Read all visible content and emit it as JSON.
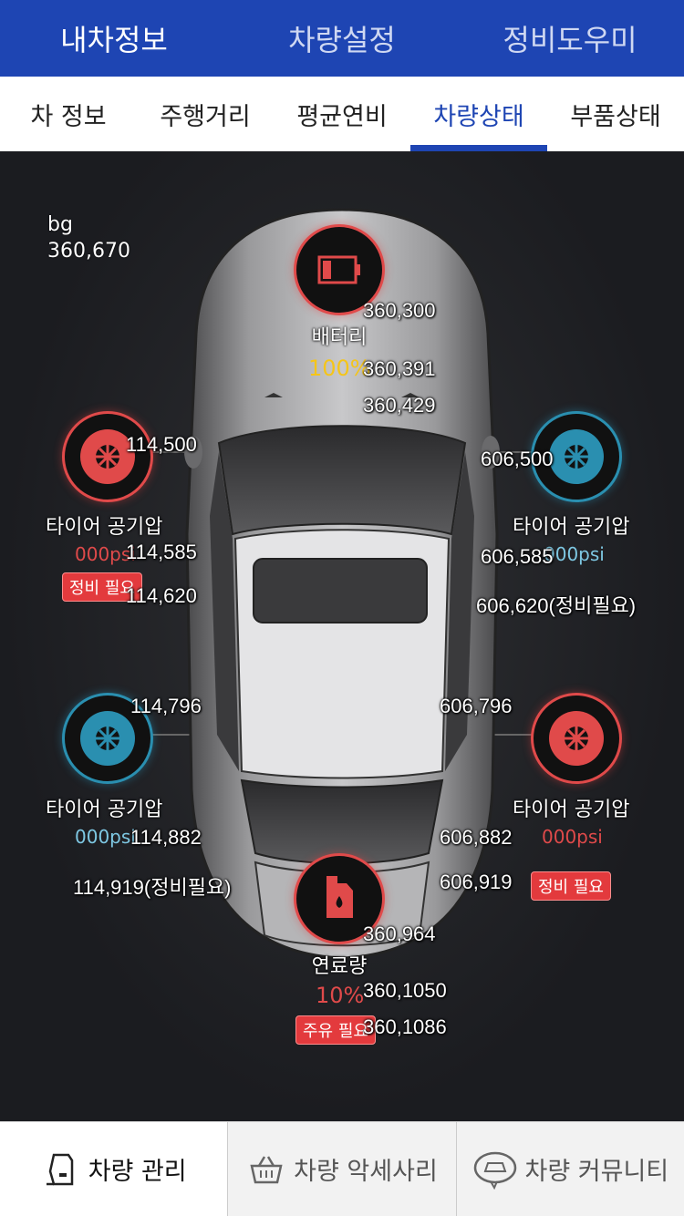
{
  "header": {
    "tabs": [
      "내차정보",
      "차량설정",
      "정비도우미"
    ]
  },
  "subnav": {
    "tabs": [
      "차 정보",
      "주행거리",
      "평균연비",
      "차량상태",
      "부품상태"
    ],
    "active_index": 3
  },
  "status": {
    "bg_label": "bg",
    "bg_coord": "360,670",
    "battery": {
      "label": "배터리",
      "value": "100%",
      "coords": [
        "360,300",
        "360,391",
        "360,429"
      ]
    },
    "tire_fl": {
      "label": "타이어 공기압",
      "value": "000psi",
      "badge": "정비 필요",
      "coords": [
        "114,500",
        "114,585",
        "114,620"
      ]
    },
    "tire_fr": {
      "label": "타이어 공기압",
      "value": "000psi",
      "coords": [
        "606,500",
        "606,585",
        "606,620(정비필요)"
      ]
    },
    "tire_rl": {
      "label": "타이어 공기압",
      "value": "000psi",
      "coords": [
        "114,796",
        "114,882",
        "114,919(정비필요)"
      ]
    },
    "tire_rr": {
      "label": "타이어 공기압",
      "value": "000psi",
      "badge": "정비 필요",
      "coords": [
        "606,796",
        "606,882",
        "606,919"
      ]
    },
    "fuel": {
      "label": "연료량",
      "value": "10%",
      "badge": "주유 필요",
      "coords": [
        "360,964",
        "360,1050",
        "360,1086"
      ]
    }
  },
  "colors": {
    "brand": "#1e45b3",
    "alert": "#e33a3d",
    "ok": "#2a8fb0",
    "battery_value": "#f5c518"
  },
  "footer": {
    "tabs": [
      "차량 관리",
      "차량 악세사리",
      "차량 커뮤니티"
    ]
  }
}
